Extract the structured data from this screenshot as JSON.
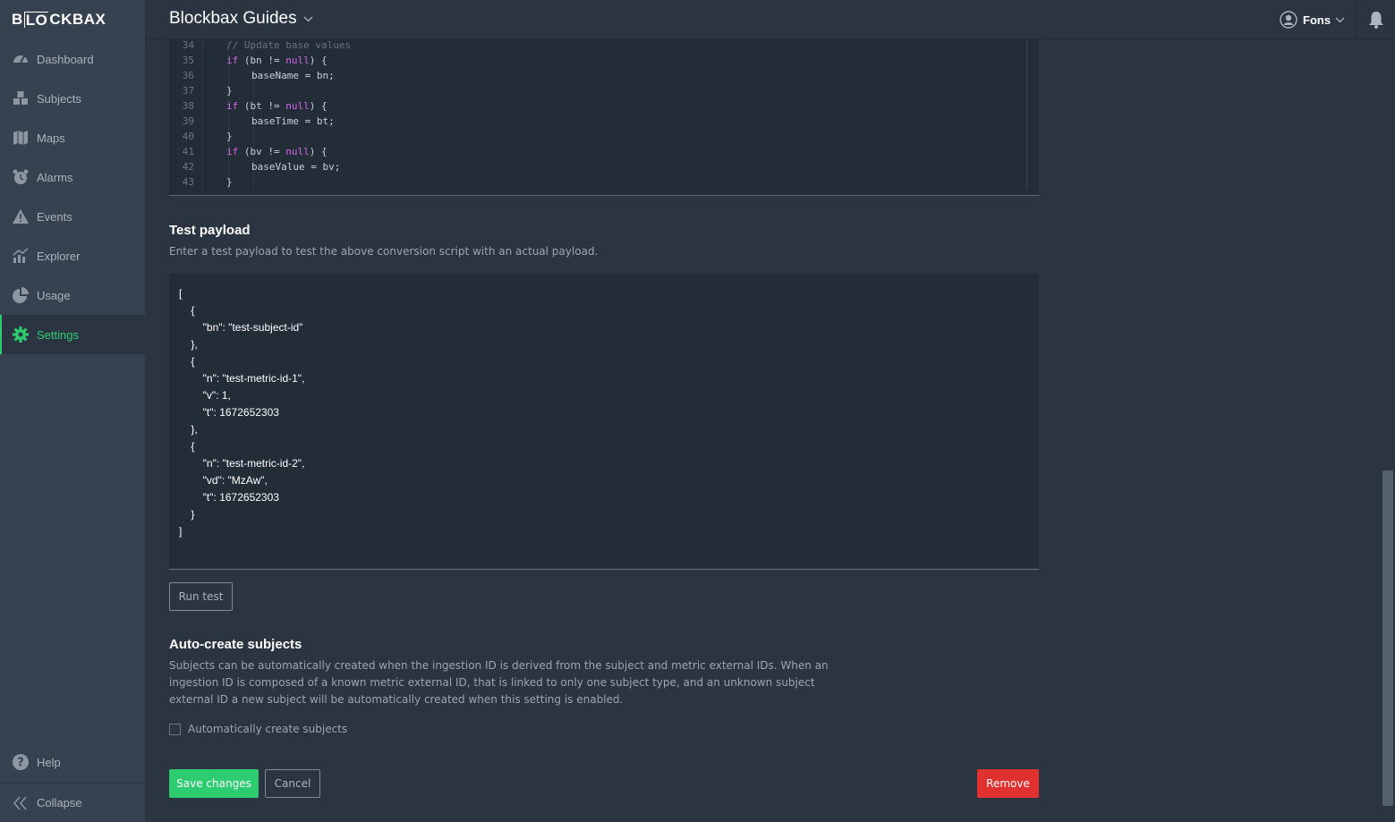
{
  "logo": {
    "pre": "B",
    "boxed": "LO",
    "post": "CKBAX"
  },
  "sidebar": {
    "items": [
      {
        "label": "Dashboard",
        "icon": "dashboard-icon"
      },
      {
        "label": "Subjects",
        "icon": "subjects-icon"
      },
      {
        "label": "Maps",
        "icon": "map-icon"
      },
      {
        "label": "Alarms",
        "icon": "alarm-clock-icon"
      },
      {
        "label": "Events",
        "icon": "warning-icon"
      },
      {
        "label": "Explorer",
        "icon": "chart-icon"
      },
      {
        "label": "Usage",
        "icon": "pie-chart-icon"
      },
      {
        "label": "Settings",
        "icon": "gear-icon",
        "active": true
      }
    ],
    "help_label": "Help",
    "collapse_label": "Collapse"
  },
  "topbar": {
    "project_title": "Blockbax Guides",
    "user_name": "Fons"
  },
  "code_editor": {
    "lines": [
      {
        "n": "34",
        "text": "// Update base values",
        "type": "comment",
        "indent": 1
      },
      {
        "n": "35",
        "text_a": "if",
        "text_b": " (bn != ",
        "text_c": "null",
        "text_d": ") {",
        "type": "if",
        "indent": 1
      },
      {
        "n": "36",
        "text": "baseName = bn;",
        "type": "plain",
        "indent": 2
      },
      {
        "n": "37",
        "text": "}",
        "type": "plain",
        "indent": 1
      },
      {
        "n": "38",
        "text_a": "if",
        "text_b": " (bt != ",
        "text_c": "null",
        "text_d": ") {",
        "type": "if",
        "indent": 1
      },
      {
        "n": "39",
        "text": "baseTime = bt;",
        "type": "plain",
        "indent": 2
      },
      {
        "n": "40",
        "text": "}",
        "type": "plain",
        "indent": 1
      },
      {
        "n": "41",
        "text_a": "if",
        "text_b": " (bv != ",
        "text_c": "null",
        "text_d": ") {",
        "type": "if",
        "indent": 1
      },
      {
        "n": "42",
        "text": "baseValue = bv;",
        "type": "plain",
        "indent": 2
      },
      {
        "n": "43",
        "text": "}",
        "type": "plain",
        "indent": 1
      }
    ]
  },
  "test_payload": {
    "title": "Test payload",
    "description": "Enter a test payload to test the above conversion script with an actual payload.",
    "value": "[\n    {\n        \"bn\": \"test-subject-id\"\n    },\n    {\n        \"n\": \"test-metric-id-1\",\n        \"v\": 1,\n        \"t\": 1672652303\n    },\n    {\n        \"n\": \"test-metric-id-2\",\n        \"vd\": \"MzAw\",\n        \"t\": 1672652303\n    }\n]",
    "run_label": "Run test"
  },
  "auto_create": {
    "title": "Auto-create subjects",
    "description_1": "Subjects can be automatically created when the ingestion ID is derived from the subject and metric external IDs. When an",
    "description_2": "ingestion ID is composed of a known metric external ID, that is linked to only one subject type, and an unknown subject",
    "description_3": "external ID a new subject will be automatically created when this setting is enabled.",
    "checkbox_label": "Automatically create subjects",
    "checked": false
  },
  "actions": {
    "save_label": "Save changes",
    "cancel_label": "Cancel",
    "remove_label": "Remove"
  },
  "colors": {
    "accent": "#2ecc71",
    "danger": "#e03131",
    "sidebar_bg": "#36424f",
    "main_bg": "#2b3541"
  }
}
